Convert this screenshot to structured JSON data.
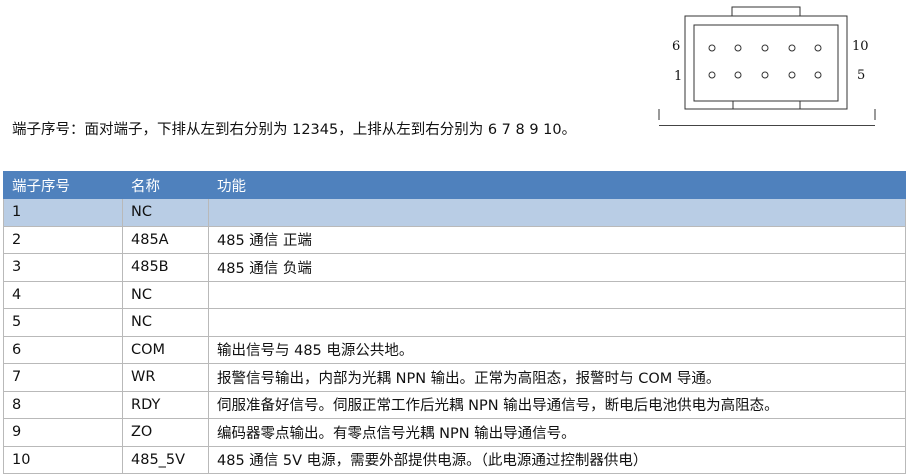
{
  "diagram": {
    "top_left_label": "6",
    "bottom_left_label": "1",
    "top_right_label": "10",
    "bottom_right_label": "5"
  },
  "description": "端子序号：面对端子，下排从左到右分别为 12345，上排从左到右分别为 6 7 8 9 10。",
  "table": {
    "headers": [
      "端子序号",
      "名称",
      "功能"
    ],
    "rows": [
      [
        "1",
        "NC",
        ""
      ],
      [
        "2",
        "485A",
        "485 通信  正端"
      ],
      [
        "3",
        "485B",
        "485 通信  负端"
      ],
      [
        "4",
        "NC",
        ""
      ],
      [
        "5",
        "NC",
        ""
      ],
      [
        "6",
        "COM",
        "输出信号与 485 电源公共地。"
      ],
      [
        "7",
        "WR",
        "报警信号输出，内部为光耦 NPN 输出。正常为高阻态，报警时与 COM 导通。"
      ],
      [
        "8",
        "RDY",
        "伺服准备好信号。伺服正常工作后光耦 NPN 输出导通信号，断电后电池供电为高阻态。"
      ],
      [
        "9",
        "ZO",
        "编码器零点输出。有零点信号光耦 NPN 输出导通信号。"
      ],
      [
        "10",
        "485_5V",
        "485 通信 5V 电源，需要外部提供电源。（此电源通过控制器供电）"
      ]
    ]
  }
}
